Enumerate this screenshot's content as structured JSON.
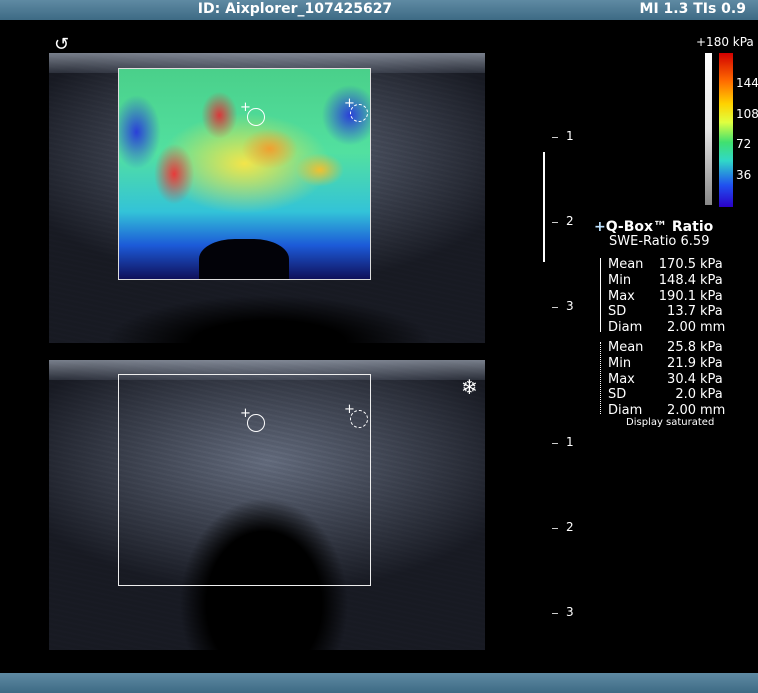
{
  "header": {
    "id": "ID: Aixplorer_107425627",
    "mi": "MI 1.3  TIs 0.9"
  },
  "colorbar": {
    "max_label": "+180 kPa",
    "ticks": [
      "144",
      "108",
      "72",
      "36"
    ]
  },
  "depth_scale_top": [
    "1",
    "2",
    "3"
  ],
  "depth_scale_bottom": [
    "1",
    "2",
    "3"
  ],
  "icons": {
    "mode": "swirl-icon",
    "freeze": "snowflake-icon"
  },
  "qbox": {
    "title": "Q-Box™ Ratio",
    "ratio": "SWE-Ratio 6.59",
    "roi1": {
      "mean": "170.5",
      "min": "148.4",
      "max": "190.1",
      "sd": "13.7",
      "diam": "2.00"
    },
    "roi2": {
      "mean": "25.8",
      "min": "21.9",
      "max": "30.4",
      "sd": "2.0",
      "diam": "2.00"
    },
    "labels": {
      "mean": "Mean",
      "min": "Min",
      "max": "Max",
      "sd": "SD",
      "diam": "Diam"
    },
    "units": {
      "kpa": "kPa",
      "mm": "mm"
    },
    "note": "Display saturated"
  }
}
